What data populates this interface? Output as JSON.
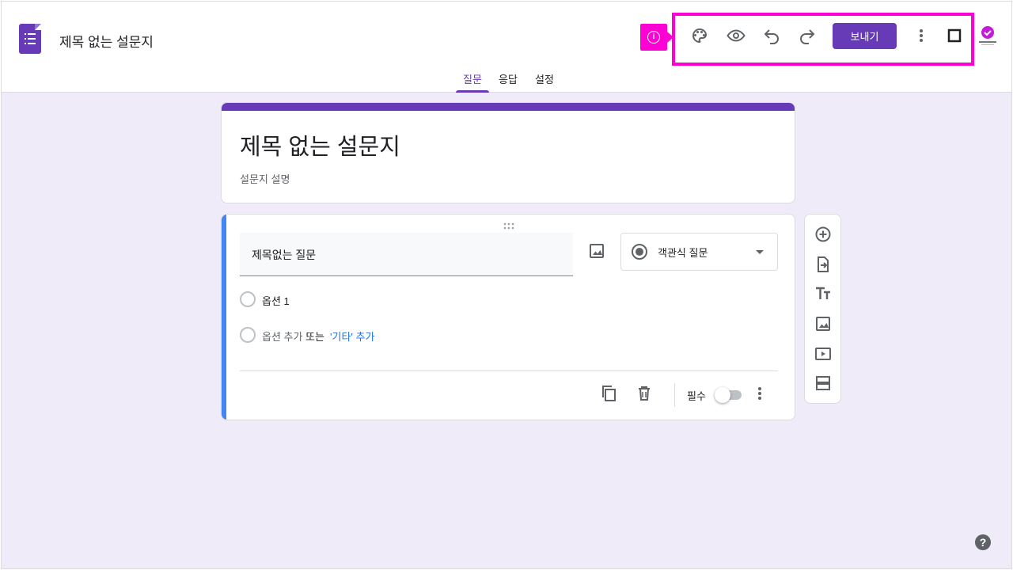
{
  "header": {
    "doc_title": "제목 없는 설문지",
    "send_label": "보내기"
  },
  "tabs": [
    {
      "label": "질문",
      "active": true
    },
    {
      "label": "응답",
      "active": false
    },
    {
      "label": "설정",
      "active": false
    }
  ],
  "form": {
    "title": "제목 없는 설문지",
    "description": "설문지 설명"
  },
  "question": {
    "title": "제목없는 질문",
    "type": "객관식 질문",
    "options": [
      "옵션 1"
    ],
    "add_option": "옵션 추가",
    "or_text": "또는",
    "add_other": "'기타' 추가",
    "required_label": "필수"
  },
  "colors": {
    "accent": "#673ab7",
    "background": "#f0ebf8",
    "highlight": "#ff00d4",
    "question_bar": "#4285f4"
  },
  "icons": {
    "toolbar": [
      "palette-icon",
      "eye-icon",
      "undo-icon",
      "redo-icon",
      "more-vert-icon",
      "square-icon"
    ],
    "side": [
      "add-circle-icon",
      "import-icon",
      "title-text-icon",
      "image-icon",
      "video-icon",
      "section-icon"
    ]
  }
}
